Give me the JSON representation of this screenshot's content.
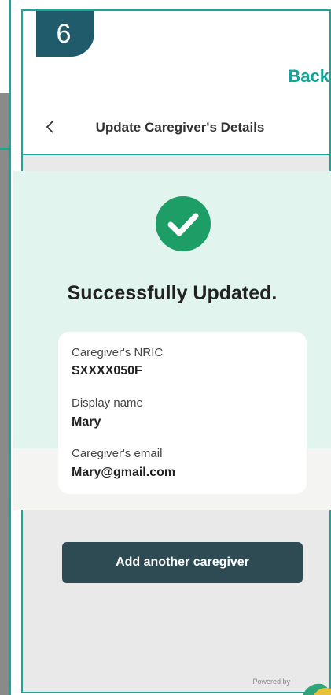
{
  "step": {
    "number": "6"
  },
  "nav": {
    "back_label": "Back"
  },
  "header": {
    "title": "Update Caregiver's Details"
  },
  "success": {
    "title": "Successfully Updated."
  },
  "details": [
    {
      "label": "Caregiver's NRIC",
      "value": "SXXXX050F"
    },
    {
      "label": "Display name",
      "value": "Mary"
    },
    {
      "label": "Caregiver's email",
      "value": "Mary@gmail.com"
    }
  ],
  "actions": {
    "add_caregiver_label": "Add another caregiver"
  },
  "footer": {
    "powered_by": "Powered by"
  },
  "colors": {
    "accent": "#1aa79a",
    "badge": "#1f5b6a",
    "success_green": "#1e9e67",
    "button": "#2e4a53"
  }
}
